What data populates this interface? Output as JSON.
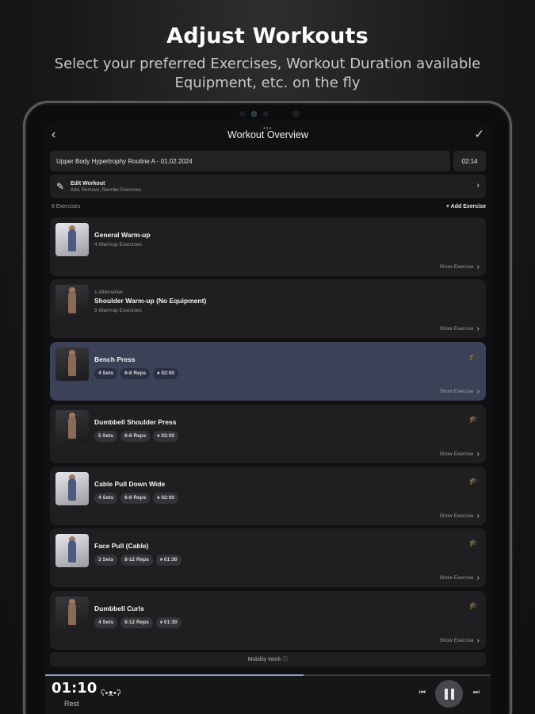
{
  "promo": {
    "headline": "Adjust Workouts",
    "subline": "Select your preferred Exercises, Workout Duration available Equipment,  etc. on the fly"
  },
  "header": {
    "title": "Workout Overview",
    "back_icon": "chevron-left-icon",
    "confirm_icon": "checkmark-icon"
  },
  "workout": {
    "name": "Upper Body Hypertrophy Routine A - 01.02.2024",
    "time": "02:14"
  },
  "edit": {
    "title": "Edit Workout",
    "subtitle": "Add, Remove, Reorder Exercises"
  },
  "list": {
    "count_label": "8 Exercises",
    "add_label": "Add Exercise"
  },
  "exercises": [
    {
      "pre": "",
      "name": "General Warm-up",
      "sub": "4 Warmup Exercises",
      "badges": [],
      "show": "Show Exercise"
    },
    {
      "pre": "1 Alternative",
      "name": "Shoulder Warm-up (No Equipment)",
      "sub": "5 Warmup Exercises",
      "badges": [],
      "show": "Show Exercise"
    },
    {
      "pre": "",
      "name": "Bench Press",
      "sub": "",
      "badges": [
        "4 Sets",
        "6-8 Reps",
        "⏸ 02:00"
      ],
      "show": "Show Exercise",
      "active": true
    },
    {
      "pre": "",
      "name": "Dumbbell Shoulder Press",
      "sub": "",
      "badges": [
        "5 Sets",
        "6-8 Reps",
        "⏸ 02:00"
      ],
      "show": "Show Exercise"
    },
    {
      "pre": "",
      "name": "Cable Pull Down Wide",
      "sub": "",
      "badges": [
        "4 Sets",
        "6-8 Reps",
        "⏸ 02:00"
      ],
      "show": "Show Exercise"
    },
    {
      "pre": "",
      "name": "Face Pull (Cable)",
      "sub": "",
      "badges": [
        "3 Sets",
        "8-12 Reps",
        "⏸ 01:30"
      ],
      "show": "Show Exercise"
    },
    {
      "pre": "",
      "name": "Dumbbell Curls",
      "sub": "",
      "badges": [
        "4 Sets",
        "8-12 Reps",
        "⏸ 01:30"
      ],
      "show": "Show Exercise"
    }
  ],
  "mobility": {
    "label": "Mobility Work ⓘ"
  },
  "player": {
    "timer": "01:10",
    "label": "Rest",
    "progress": 0.58
  },
  "colors": {
    "accent": "#3b4258",
    "progress": "#8a9ad0",
    "card": "#1f1f22"
  }
}
